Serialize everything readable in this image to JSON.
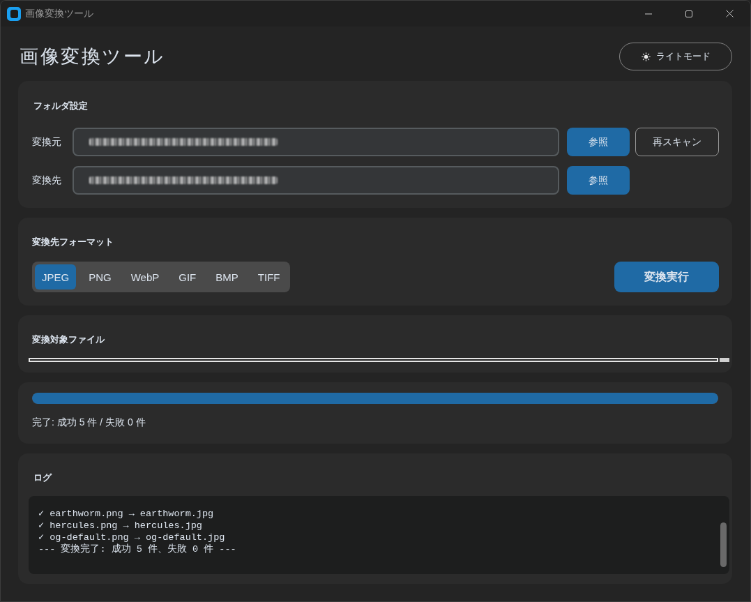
{
  "window": {
    "title": "画像変換ツール"
  },
  "header": {
    "title": "画像変換ツール",
    "theme_button": {
      "label": "ライトモード"
    }
  },
  "folder_settings": {
    "title": "フォルダ設定",
    "rows": [
      {
        "label": "変換元",
        "blurred": true,
        "buttons": [
          {
            "label": "参照",
            "kind": "primary"
          },
          {
            "label": "再スキャン",
            "kind": "outline"
          }
        ]
      },
      {
        "label": "変換先",
        "blurred": true,
        "buttons": [
          {
            "label": "参照",
            "kind": "primary"
          }
        ]
      }
    ]
  },
  "format": {
    "title": "変換先フォーマット",
    "options": [
      {
        "label": "JPEG",
        "selected": true
      },
      {
        "label": "PNG",
        "selected": false
      },
      {
        "label": "WebP",
        "selected": false
      },
      {
        "label": "GIF",
        "selected": false
      },
      {
        "label": "BMP",
        "selected": false
      },
      {
        "label": "TIFF",
        "selected": false
      }
    ],
    "convert_button": "変換実行"
  },
  "files": {
    "title": "変換対象ファイル"
  },
  "progress": {
    "level": 1,
    "status": "完了: 成功 5 件 / 失敗 0 件"
  },
  "log": {
    "title": "ログ",
    "lines": [
      "✓ earthworm.png → earthworm.jpg",
      "✓ hercules.png → hercules.jpg",
      "✓ og-default.png → og-default.jpg",
      "--- 変換完了: 成功 5 件、失敗 0 件 ---"
    ]
  }
}
